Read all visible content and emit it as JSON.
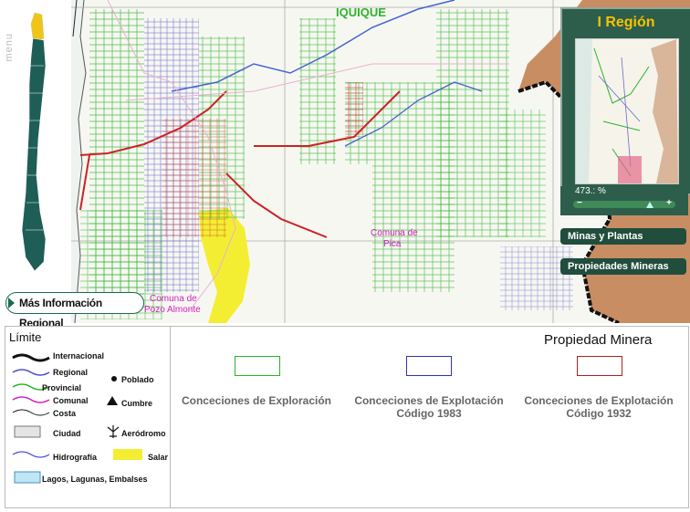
{
  "sidebar": {
    "menu_label": "menu"
  },
  "map": {
    "labels": {
      "city_top": "IQUIQUE",
      "comuna_pica": "Comuna de\nPica",
      "comuna_pozo": "Comuna de\nPozo Almonte"
    }
  },
  "more_info": {
    "label": "Más Información Regional"
  },
  "region_panel": {
    "title": "I Región",
    "zoom_value": "473.: %"
  },
  "buttons": {
    "minas": "Minas y Plantas",
    "propiedades": "Propiedades Mineras"
  },
  "legend": {
    "title": "Límite",
    "items": {
      "internacional": "Internacional",
      "regional": "Regional",
      "provincial": "Provincial",
      "comunal": "Comunal",
      "costa": "Costa",
      "poblado": "Poblado",
      "cumbre": "Cumbre",
      "ciudad": "Ciudad",
      "aerodromo": "Aeródromo",
      "hidrografia": "Hidrografía",
      "salar": "Salar",
      "lagos": "Lagos, Lagunas, Embalses"
    },
    "property": {
      "title": "Propiedad Minera",
      "exploracion": "Conceciones de Exploración",
      "explotacion_1983": "Conceciones de Explotación\nCódigo 1983",
      "explotacion_1932": "Conceciones de Explotación\nCódigo 1932"
    }
  },
  "colors": {
    "exploracion": "#2bb32b",
    "explotacion_1983": "#3333aa",
    "explotacion_1932": "#aa2222",
    "salar": "#f4ee33",
    "panel": "#2d5e4c"
  }
}
